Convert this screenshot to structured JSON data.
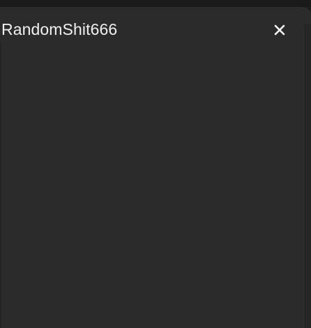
{
  "window": {
    "title": "RandomShit666",
    "close_icon": "close-icon"
  },
  "colors": {
    "background": "#2b2b2b",
    "title_text": "#f0f0f0",
    "close_icon": "#f5f5f5"
  }
}
